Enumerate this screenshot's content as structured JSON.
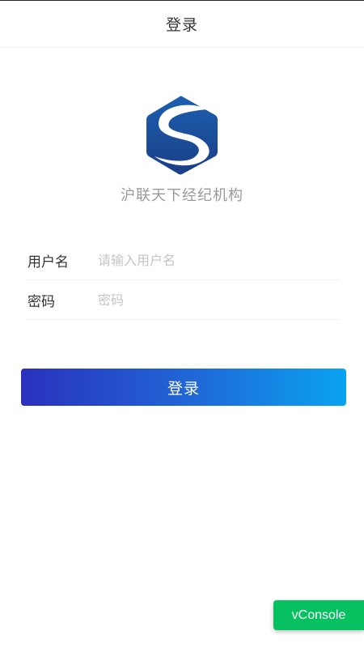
{
  "navbar": {
    "title": "登录"
  },
  "brand": {
    "logo_icon": "hexagon-s-logo-icon",
    "org_name": "沪联天下经纪机构"
  },
  "form": {
    "username": {
      "label": "用户名",
      "placeholder": "请输入用户名",
      "value": ""
    },
    "password": {
      "label": "密码",
      "placeholder": "密码",
      "value": ""
    }
  },
  "login_button": {
    "label": "登录"
  },
  "vconsole": {
    "label": "vConsole"
  },
  "colors": {
    "gradient_start": "#2a31bd",
    "gradient_end": "#0aa3f2",
    "vconsole_green": "#07c160",
    "logo_blue": "#1f4f9a"
  }
}
